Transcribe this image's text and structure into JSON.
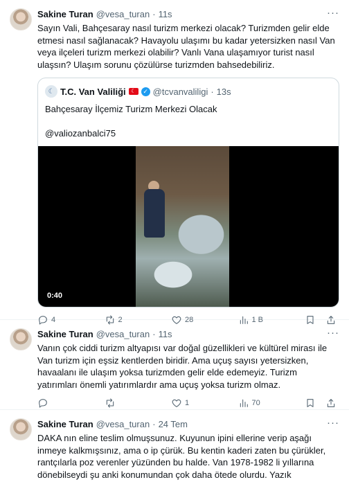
{
  "tweets": [
    {
      "name": "Sakine Turan",
      "handle": "@vesa_turan",
      "dot": "·",
      "time": "11s",
      "text": "Sayın Vali, Bahçesaray nasıl turizm merkezi olacak? Turizmden gelir elde etmesi nasıl sağlanacak? Havayolu ulaşımı bu kadar yetersizken nasıl Van veya ilçeleri turizm merkezi olabilir? Vanlı Vana ulaşamıyor turist nasıl ulaşsın? Ulaşım sorunu çözülürse turizmden bahsedebiliriz.",
      "quote": {
        "name": "T.C. Van Valiliği",
        "handle": "@tcvanvaliligi",
        "dot": "·",
        "time": "13s",
        "line1": "Bahçesaray İlçemiz Turizm Merkezi Olacak",
        "line2": "@valiozanbalci75",
        "video_duration": "0:40"
      },
      "actions": {
        "replies": "4",
        "retweets": "2",
        "likes": "28",
        "views": "1 B"
      }
    },
    {
      "name": "Sakine Turan",
      "handle": "@vesa_turan",
      "dot": "·",
      "time": "11s",
      "text": "Vanın çok ciddi turizm altyapısı var doğal güzellikleri ve kültürel mirası ile Van turizm için eşsiz kentlerden biridir. Ama uçuş sayısı yetersizken, havaalanı ile ulaşım yoksa turizmden gelir elde edemeyiz. Turizm yatırımları önemli yatırımlardır ama uçuş yoksa turizm olmaz.",
      "actions": {
        "replies": "",
        "retweets": "",
        "likes": "1",
        "views": "70"
      }
    },
    {
      "name": "Sakine Turan",
      "handle": "@vesa_turan",
      "dot": "·",
      "time": "24 Tem",
      "text": "DAKA nın eline teslim olmuşsunuz. Kuyunun ipini ellerine verip aşağı inmeye kalkmışsınız, ama o ip çürük. Bu kentin kaderi zaten bu çürükler, rantçılarla poz verenler yüzünden bu halde. Van 1978-1982 li yıllarına dönebilseydi şu anki konumundan çok daha ötede olurdu. Yazık"
    }
  ],
  "more_label": "···",
  "icons": [
    "reply-icon",
    "retweet-icon",
    "like-icon",
    "views-icon",
    "bookmark-icon",
    "share-icon",
    "verified-icon",
    "flag-icon"
  ]
}
